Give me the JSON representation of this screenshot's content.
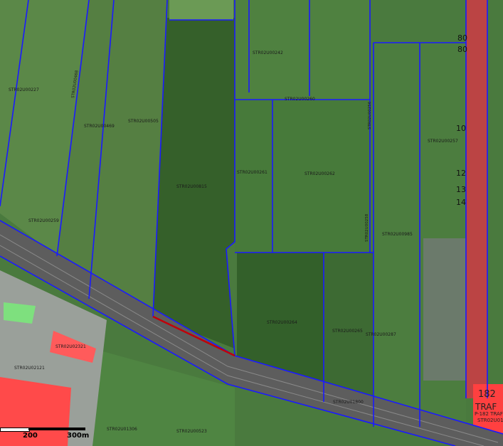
{
  "map": {
    "parcel_labels": [
      {
        "text": "STR02U00227"
      },
      {
        "text": "STR02U00468"
      },
      {
        "text": "STR02U00469"
      },
      {
        "text": "STR02U00505"
      },
      {
        "text": "STR02U00242"
      },
      {
        "text": "STR02U00260"
      },
      {
        "text": "STR02U00256"
      },
      {
        "text": "STR02U00257"
      },
      {
        "text": "STR02U00261"
      },
      {
        "text": "STR02U00262"
      },
      {
        "text": "STR02U00259"
      },
      {
        "text": "STR02U00258"
      },
      {
        "text": "STR02U00985"
      },
      {
        "text": "STR02U00815"
      },
      {
        "text": "STR02U00264"
      },
      {
        "text": "STR02U00265"
      },
      {
        "text": "STR02U00287"
      },
      {
        "text": "STR02U01800"
      },
      {
        "text": "STR02U02121"
      },
      {
        "text": "STR02U02321"
      },
      {
        "text": "STR02U01306"
      },
      {
        "text": "STR02U00523"
      },
      {
        "text": "STR02U01254"
      }
    ],
    "house_numbers": [
      "80",
      "80",
      "10",
      "12",
      "13",
      "14"
    ],
    "traf": {
      "number": "182",
      "label": "TRAF",
      "sub": "P-182 TRAF"
    },
    "colors": {
      "parcel_line": "#1a1aff",
      "building": "#ff3b3b",
      "road": "#5d5d5d",
      "forest": "#3e6a2c",
      "field": "#4d7a3d"
    }
  },
  "scale": {
    "labels": [
      "200",
      "300m"
    ]
  }
}
